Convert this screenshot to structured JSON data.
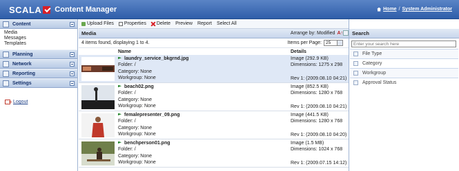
{
  "header": {
    "brand": "SCALA",
    "app_title": "Content Manager",
    "home_link": "Home",
    "separator": "/",
    "user_link": "System Administrator"
  },
  "sidebar": {
    "sections": [
      {
        "label": "Content",
        "icon": "content-icon"
      },
      {
        "label": "Planning",
        "icon": "planning-icon"
      },
      {
        "label": "Network",
        "icon": "network-icon"
      },
      {
        "label": "Reporting",
        "icon": "reporting-icon"
      },
      {
        "label": "Settings",
        "icon": "settings-icon"
      }
    ],
    "content_items": [
      "Media",
      "Messages",
      "Templates"
    ],
    "logout": "Logout"
  },
  "toolbar": {
    "upload": "Upload Files",
    "properties": "Properties",
    "delete": "Delete",
    "preview": "Preview",
    "report": "Report",
    "select_all": "Select All"
  },
  "media": {
    "title": "Media",
    "arrange_label": "Arrange by: Modified",
    "info": "4 items found, displaying 1 to 4.",
    "items_per_page_label": "Items per Page:",
    "items_per_page_value": "25",
    "col_name": "Name",
    "col_details": "Details",
    "rows": [
      {
        "name": "laundry_service_bkgrnd.jpg",
        "folder": "Folder: /",
        "category": "Category: None",
        "workgroup": "Workgroup: None",
        "type": "Image (292.9 KB)",
        "dimensions": "Dimensions: 1275 x 298",
        "rev": "Rev 1: (2009.08.10 04:21)"
      },
      {
        "name": "beach02.png",
        "folder": "Folder: /",
        "category": "Category: None",
        "workgroup": "Workgroup: None",
        "type": "Image (852.5 KB)",
        "dimensions": "Dimensions: 1280 x 768",
        "rev": "Rev 1: (2009.08.10 04:21)"
      },
      {
        "name": "femalepresenter_09.png",
        "folder": "Folder: /",
        "category": "Category: None",
        "workgroup": "Workgroup: None",
        "type": "Image (441.5 KB)",
        "dimensions": "Dimensions: 1280 x 768",
        "rev": "Rev 1: (2009.08.10 04:20)"
      },
      {
        "name": "benchperson01.png",
        "folder": "Folder: /",
        "category": "Category: None",
        "workgroup": "Workgroup: None",
        "type": "Image (1.5 MB)",
        "dimensions": "Dimensions: 1024 x 768",
        "rev": "Rev 1: (2009.07.15 14:12)"
      }
    ]
  },
  "search": {
    "title": "Search",
    "placeholder": "Enter your search here",
    "filters": [
      "File Type",
      "Category",
      "Workgroup",
      "Approval Status"
    ]
  },
  "colors": {
    "header_blue": "#2f5ea9",
    "brand_red": "#d81f26",
    "selected_row": "#dfe8f6"
  }
}
